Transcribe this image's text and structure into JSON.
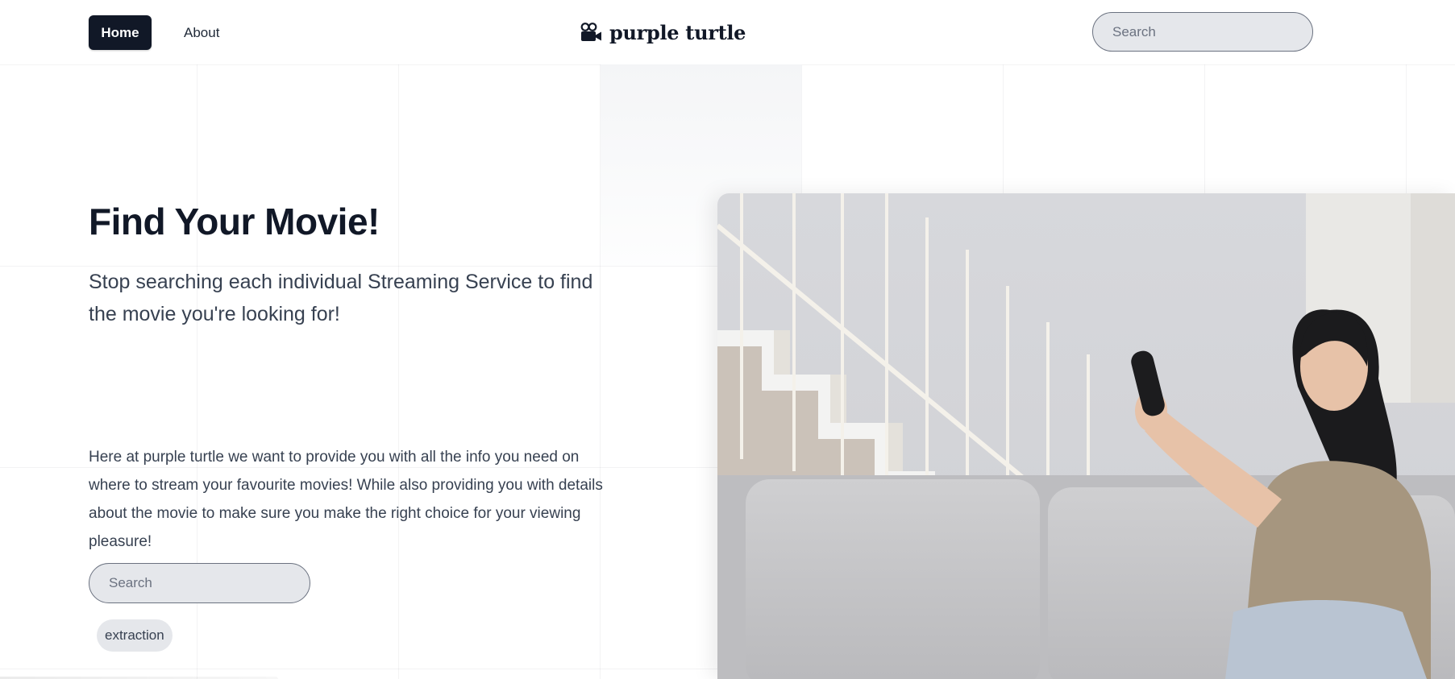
{
  "nav": {
    "home_label": "Home",
    "about_label": "About"
  },
  "brand": {
    "name": "purple turtle",
    "icon": "film-camera-icon"
  },
  "header_search": {
    "placeholder": "Search"
  },
  "hero": {
    "title": "Find Your Movie!",
    "subtitle": "Stop searching each individual Streaming Service to find the movie you're looking for!",
    "body": "Here at purple turtle we want to provide you with all the info you need on where to stream your favourite movies! While also providing you with details about the movie to make sure you make the right choice for your viewing pleasure!",
    "search_placeholder": "Search",
    "tags": [
      "extraction"
    ]
  },
  "colors": {
    "primary": "#111827",
    "input_bg": "#e5e7eb",
    "text_muted": "#374151"
  }
}
